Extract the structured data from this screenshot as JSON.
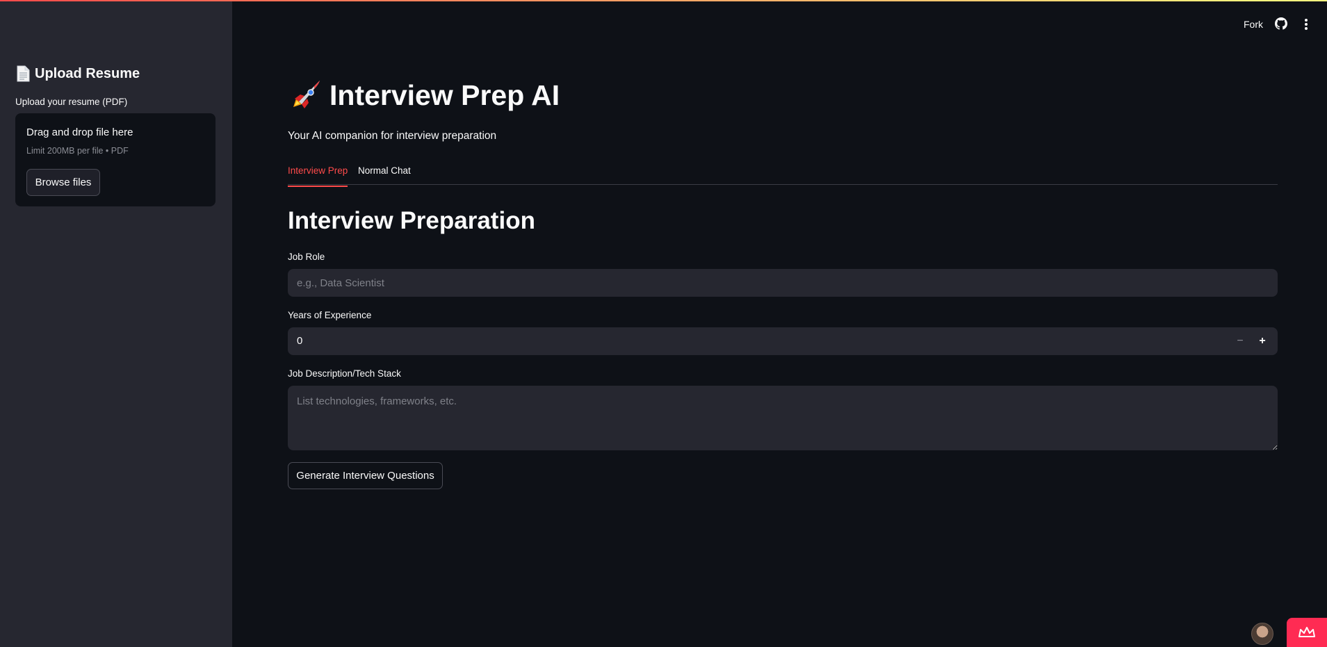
{
  "header": {
    "fork_label": "Fork",
    "github_icon": "github-icon",
    "menu_icon": "kebab-menu-icon",
    "accent": "#ff4b4b"
  },
  "sidebar": {
    "title": "Upload Resume",
    "title_icon": "document-icon",
    "upload_label": "Upload your resume (PDF)",
    "dropzone_title": "Drag and drop file here",
    "dropzone_limit": "Limit 200MB per file • PDF",
    "browse_label": "Browse files"
  },
  "main": {
    "title": "Interview Prep AI",
    "title_icon": "rocket-icon",
    "subtitle": "Your AI companion for interview preparation",
    "tabs": [
      {
        "label": "Interview Prep",
        "active": true
      },
      {
        "label": "Normal Chat",
        "active": false
      }
    ],
    "section_title": "Interview Preparation",
    "job_role": {
      "label": "Job Role",
      "placeholder": "e.g., Data Scientist",
      "value": ""
    },
    "experience": {
      "label": "Years of Experience",
      "value": "0",
      "minus": "−",
      "plus": "+"
    },
    "description": {
      "label": "Job Description/Tech Stack",
      "placeholder": "List technologies, frameworks, etc.",
      "value": ""
    },
    "generate_label": "Generate Interview Questions"
  },
  "footer": {
    "avatar": "user-avatar",
    "badge_icon": "crown-icon",
    "badge_color": "#ff2b53"
  }
}
